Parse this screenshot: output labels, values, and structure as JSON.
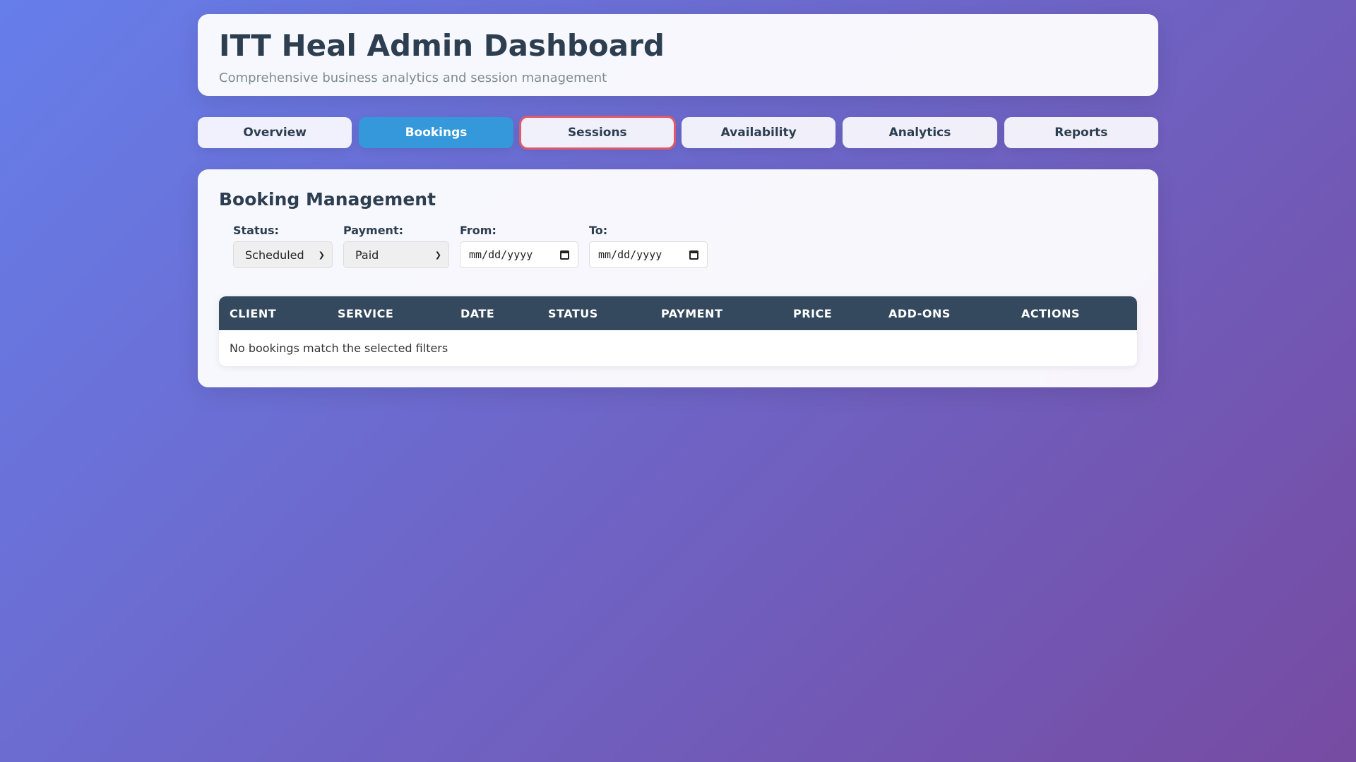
{
  "header": {
    "title": "ITT Heal Admin Dashboard",
    "subtitle": "Comprehensive business analytics and session management"
  },
  "tabs": [
    {
      "label": "Overview"
    },
    {
      "label": "Bookings"
    },
    {
      "label": "Sessions"
    },
    {
      "label": "Availability"
    },
    {
      "label": "Analytics"
    },
    {
      "label": "Reports"
    }
  ],
  "active_tab": "Bookings",
  "focused_tab": "Sessions",
  "panel": {
    "title": "Booking Management",
    "filters": {
      "status": {
        "label": "Status:",
        "value": "Scheduled"
      },
      "payment": {
        "label": "Payment:",
        "value": "Paid"
      },
      "from": {
        "label": "From:",
        "placeholder": "mm/dd/yyyy"
      },
      "to": {
        "label": "To:",
        "placeholder": "mm/dd/yyyy"
      }
    },
    "table": {
      "columns": [
        "Client",
        "Service",
        "Date",
        "Status",
        "Payment",
        "Price",
        "Add-ons",
        "Actions"
      ],
      "empty_message": "No bookings match the selected filters"
    }
  },
  "colors": {
    "accent": "#3498db",
    "table_header": "#34495e",
    "focus_outline": "#e05a6a"
  }
}
